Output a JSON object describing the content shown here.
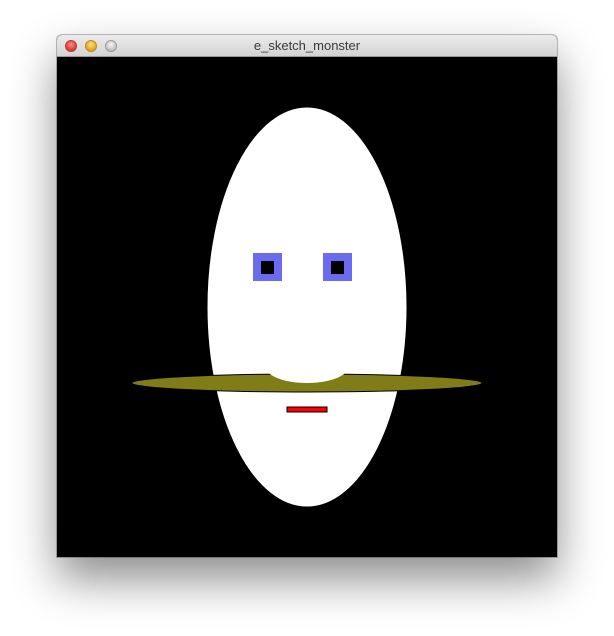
{
  "window": {
    "title": "e_sketch_monster",
    "controls": {
      "close_icon": "close-icon",
      "minimize_icon": "minimize-icon",
      "zoom_icon": "zoom-icon"
    }
  },
  "sketch": {
    "background_color": "#000000",
    "face_color": "#ffffff",
    "eye_outer_color": "#6b6bf0",
    "pupil_color": "#000000",
    "mustache_color": "#807d18",
    "mouth_color": "#ff0000"
  }
}
